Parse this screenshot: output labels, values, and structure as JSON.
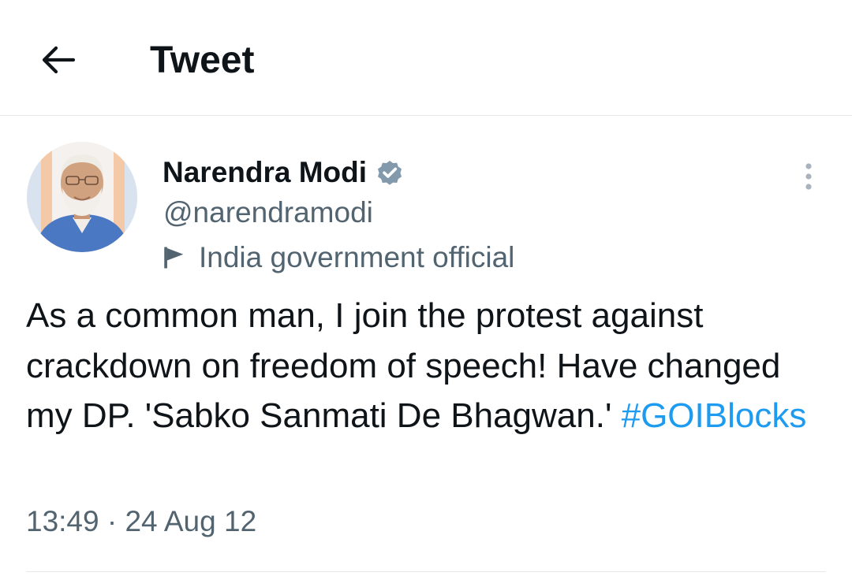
{
  "header": {
    "back_icon": "arrow-left-icon",
    "title": "Tweet"
  },
  "tweet": {
    "author": {
      "name": "Narendra Modi",
      "verified_icon": "verified-badge-icon",
      "handle": "@narendramodi",
      "label_icon": "flag-icon",
      "label": "India government official"
    },
    "more_icon": "more-vertical-icon",
    "text": "As a common man, I join the protest against crackdown on freedom of speech! Have changed my DP. 'Sabko Sanmati De Bhagwan.' ",
    "hashtag": "#GOIBlocks",
    "time": "13:49",
    "separator": "·",
    "date": "24 Aug 12"
  },
  "colors": {
    "text_primary": "#0f1419",
    "text_secondary": "#536471",
    "link": "#1d9bf0",
    "divider": "#e6e8ea"
  }
}
